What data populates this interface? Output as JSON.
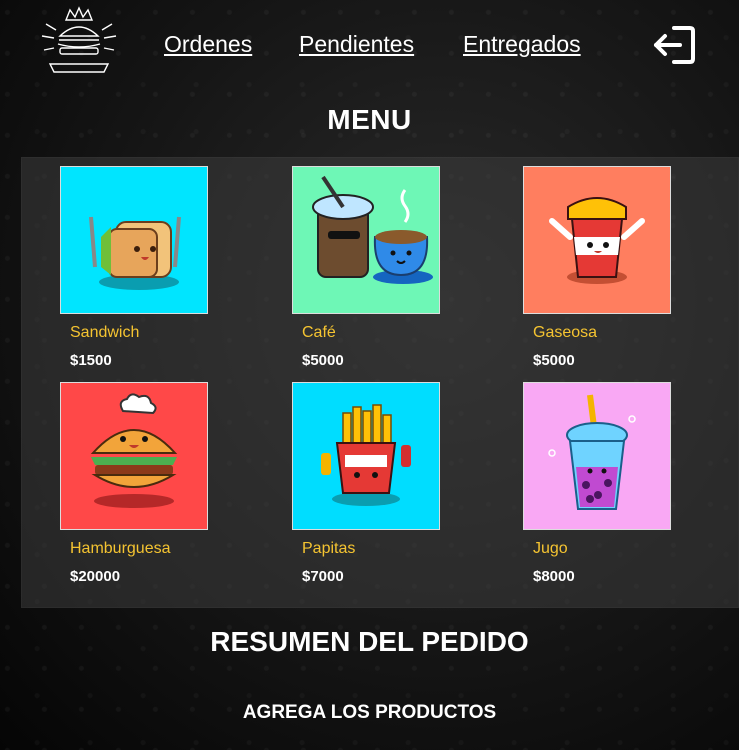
{
  "nav": {
    "links": [
      "Ordenes",
      "Pendientes",
      "Entregados"
    ]
  },
  "icons": {
    "logo": "burger-crown-logo",
    "logout": "logout-icon"
  },
  "menu": {
    "title": "MENU",
    "products": [
      {
        "name": "Sandwich",
        "price": "$1500",
        "bg": "#00e5ff",
        "icon": "sandwich-icon"
      },
      {
        "name": "Café",
        "price": "$5000",
        "bg": "#6ef7b6",
        "icon": "coffee-icon"
      },
      {
        "name": "Gaseosa",
        "price": "$5000",
        "bg": "#ff7e5f",
        "icon": "soda-icon"
      },
      {
        "name": "Hamburguesa",
        "price": "$20000",
        "bg": "#ff4848",
        "icon": "burger-icon"
      },
      {
        "name": "Papitas",
        "price": "$7000",
        "bg": "#00ddff",
        "icon": "fries-icon"
      },
      {
        "name": "Jugo",
        "price": "$8000",
        "bg": "#f9a8f4",
        "icon": "bubble-tea-icon"
      }
    ]
  },
  "summary": {
    "title": "RESUMEN DEL PEDIDO",
    "subtitle": "AGREGA LOS PRODUCTOS"
  },
  "colors": {
    "accent_name": "#f5c431",
    "price": "#ffffff"
  }
}
